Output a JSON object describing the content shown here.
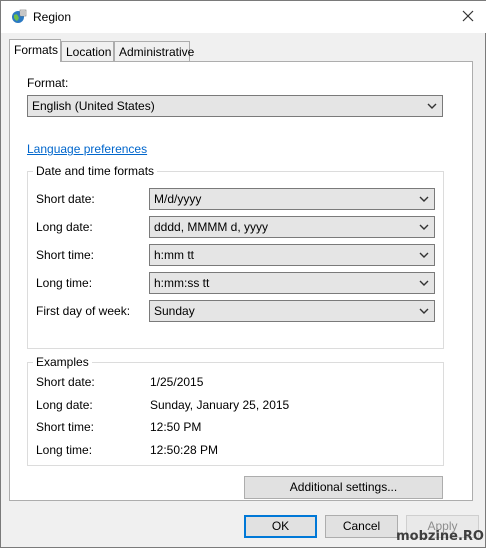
{
  "window": {
    "title": "Region"
  },
  "tabs": [
    "Formats",
    "Location",
    "Administrative"
  ],
  "formats": {
    "format_label": "Format:",
    "format_value": "English (United States)",
    "language_link": "Language preferences"
  },
  "datetime": {
    "group_title": "Date and time formats",
    "rows": [
      {
        "label": "Short date:",
        "value": "M/d/yyyy"
      },
      {
        "label": "Long date:",
        "value": "dddd, MMMM d, yyyy"
      },
      {
        "label": "Short time:",
        "value": "h:mm tt"
      },
      {
        "label": "Long time:",
        "value": "h:mm:ss tt"
      },
      {
        "label": "First day of week:",
        "value": "Sunday"
      }
    ]
  },
  "examples": {
    "group_title": "Examples",
    "rows": [
      {
        "label": "Short date:",
        "value": "1/25/2015"
      },
      {
        "label": "Long date:",
        "value": "Sunday, January 25, 2015"
      },
      {
        "label": "Short time:",
        "value": "12:50 PM"
      },
      {
        "label": "Long time:",
        "value": "12:50:28 PM"
      }
    ]
  },
  "buttons": {
    "additional": "Additional settings...",
    "ok": "OK",
    "cancel": "Cancel",
    "apply": "Apply"
  },
  "watermark": "mobzine.RO"
}
